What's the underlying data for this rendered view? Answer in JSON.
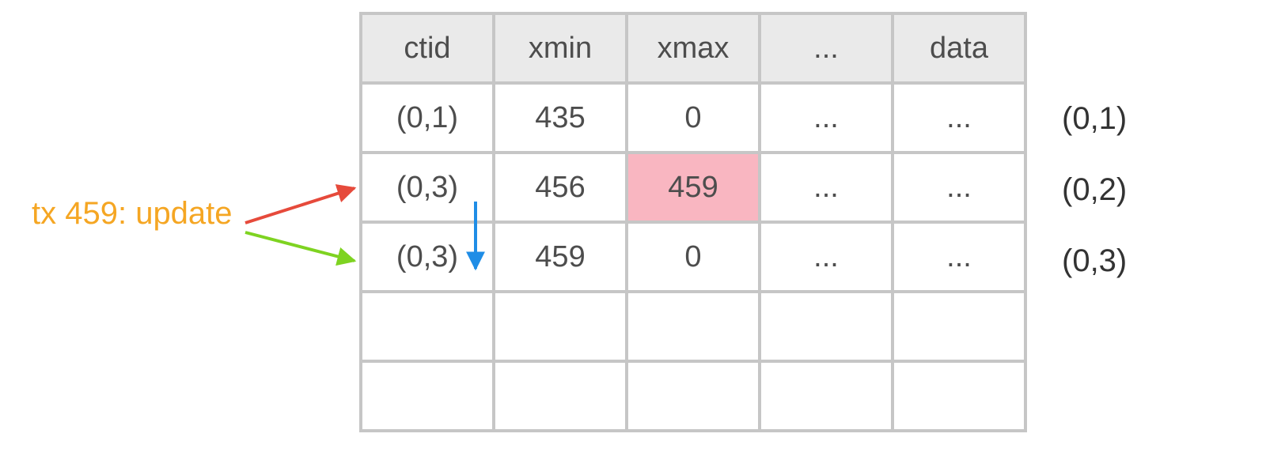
{
  "tx_label": "tx 459: update",
  "headers": {
    "ctid": "ctid",
    "xmin": "xmin",
    "xmax": "xmax",
    "dots": "...",
    "data": "data"
  },
  "rows": [
    {
      "ctid": "(0,1)",
      "xmin": "435",
      "xmax": "0",
      "dots": "...",
      "data": "...",
      "label": "(0,1)"
    },
    {
      "ctid": "(0,3)",
      "xmin": "456",
      "xmax": "459",
      "dots": "...",
      "data": "...",
      "label": "(0,2)"
    },
    {
      "ctid": "(0,3)",
      "xmin": "459",
      "xmax": "0",
      "dots": "...",
      "data": "...",
      "label": "(0,3)"
    }
  ],
  "colors": {
    "highlight": "#f9b6c1",
    "tx_label": "#f5a623",
    "arrow_red": "#e64a3b",
    "arrow_green": "#7ed321",
    "arrow_blue": "#1f8de6"
  }
}
